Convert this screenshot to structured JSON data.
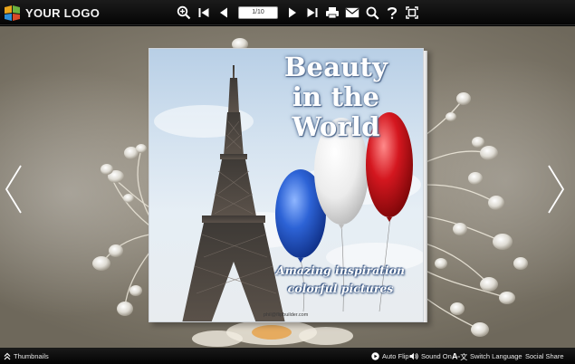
{
  "toolbar": {
    "logo_text": "YOUR LOGO",
    "page_indicator": "1/10",
    "icons": [
      "zoom-in-icon",
      "first-page-icon",
      "prev-page-icon",
      "next-page-icon",
      "last-page-icon",
      "print-icon",
      "email-icon",
      "search-icon",
      "help-icon",
      "fullscreen-icon"
    ]
  },
  "cover": {
    "title_line1": "Beauty",
    "title_line2": "in the World",
    "subtitle_line1": "Amazing inspiration",
    "subtitle_line2": "colorful pictures",
    "email": "phil@flipbuilder.com"
  },
  "bottom_bar": {
    "thumbnails_label": "Thumbnails",
    "auto_flip_label": "Auto Flip",
    "sound_label": "Sound On",
    "language_label": "Switch Language",
    "share_label": "Social Share"
  },
  "colors": {
    "toolbar_bg": "#0d0d0d",
    "balloon_blue": "#1f56c8",
    "balloon_white": "#f3f3f3",
    "balloon_red": "#d0141b"
  }
}
